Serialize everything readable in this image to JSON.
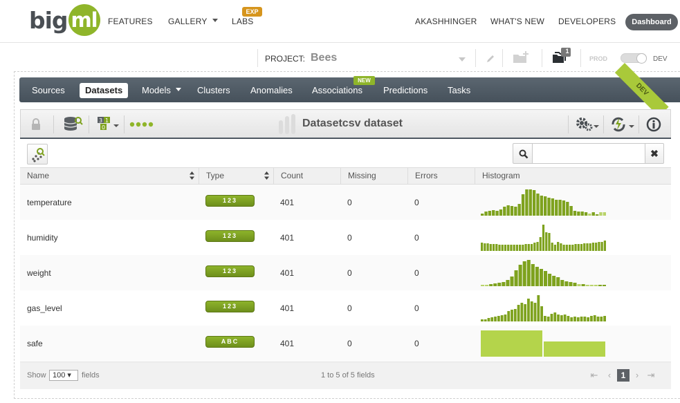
{
  "topnav": {
    "logo_big": "big",
    "logo_ml": "ml",
    "features": "FEATURES",
    "gallery": "GALLERY",
    "labs": "LABS",
    "labs_badge": "EXP",
    "user": "AKASHHINGER",
    "whats_new": "WHAT'S NEW",
    "developers": "DEVELOPERS",
    "dashboard": "Dashboard"
  },
  "project": {
    "label": "PROJECT:",
    "name": "Bees",
    "icons": [
      "pencil-icon",
      "new-folder-icon",
      "folders-icon"
    ],
    "folder_count": "1",
    "prod_label": "PROD",
    "dev_label": "DEV",
    "ribbon": "DEV"
  },
  "tabs": [
    {
      "label": "Sources"
    },
    {
      "label": "Datasets",
      "active": true
    },
    {
      "label": "Models",
      "dropdown": true
    },
    {
      "label": "Clusters"
    },
    {
      "label": "Anomalies"
    },
    {
      "label": "Associations",
      "badge": "NEW"
    },
    {
      "label": "Predictions"
    },
    {
      "label": "Tasks"
    }
  ],
  "dataset": {
    "title": "Datasetcsv dataset",
    "toolbar_icons": [
      "lock-icon",
      "dataset-search-icon",
      "field-order-icon",
      "dots-icon",
      "configure-icon",
      "one-click-icon",
      "info-icon"
    ]
  },
  "search": {
    "placeholder": ""
  },
  "table": {
    "columns": [
      "Name",
      "Type",
      "Count",
      "Missing",
      "Errors",
      "Histogram"
    ],
    "rows": [
      {
        "name": "temperature",
        "type": "123",
        "count": "401",
        "missing": "0",
        "errors": "0",
        "hist": [
          3,
          5,
          6,
          7,
          6,
          8,
          11,
          13,
          12,
          11,
          15,
          27,
          33,
          33,
          32,
          28,
          25,
          24,
          23,
          22,
          20,
          20,
          19,
          17,
          12,
          6,
          5,
          5,
          4,
          3,
          4,
          2,
          4,
          4
        ],
        "faded": [
          29,
          32,
          33
        ]
      },
      {
        "name": "humidity",
        "type": "123",
        "count": "401",
        "missing": "0",
        "errors": "0",
        "hist": [
          10,
          9,
          9,
          8,
          8,
          8,
          7,
          7,
          7,
          7,
          7,
          7,
          7,
          7,
          7,
          8,
          8,
          8,
          10,
          11,
          16,
          31,
          22,
          21,
          10,
          7,
          11,
          9,
          7,
          7,
          7,
          7,
          8,
          8,
          8,
          9,
          9,
          9,
          10,
          10,
          11,
          11,
          12
        ],
        "faded": []
      },
      {
        "name": "weight",
        "type": "123",
        "count": "401",
        "missing": "0",
        "errors": "0",
        "hist": [
          2,
          2,
          3,
          4,
          5,
          6,
          9,
          14,
          22,
          30,
          35,
          37,
          31,
          27,
          24,
          21,
          18,
          15,
          13,
          9,
          7,
          6,
          5,
          3,
          3,
          2,
          2,
          1,
          1,
          2
        ],
        "faded": [
          0,
          1,
          23,
          25,
          26,
          27
        ]
      },
      {
        "name": "gas_level",
        "type": "123",
        "count": "401",
        "missing": "0",
        "errors": "0",
        "hist": [
          3,
          3,
          5,
          6,
          7,
          8,
          9,
          10,
          15,
          17,
          18,
          23,
          26,
          24,
          32,
          28,
          26,
          37,
          21,
          8,
          7,
          11,
          13,
          10,
          9,
          10,
          8,
          6,
          7,
          6,
          7,
          7,
          6,
          8,
          9,
          7,
          7,
          8
        ],
        "faded": []
      },
      {
        "name": "safe",
        "type": "ABC",
        "count": "401",
        "missing": "0",
        "errors": "0",
        "hist": [
          38,
          22
        ],
        "faded": [],
        "categorical": true
      }
    ]
  },
  "footer": {
    "show_label": "Show",
    "show_value": "100 ▾",
    "fields_label": "fields",
    "range_label": "1 to 5 of 5 fields",
    "current_page": "1",
    "first": "⇤",
    "prev": "‹",
    "next": "›",
    "last": "⇥"
  },
  "colors": {
    "brand_green": "#8fb52a",
    "bar_green": "#7ea21e",
    "bar_faded": "#b9d36a",
    "categorical_bar": "#b4d44b",
    "nav_dark": "#4d5761"
  }
}
